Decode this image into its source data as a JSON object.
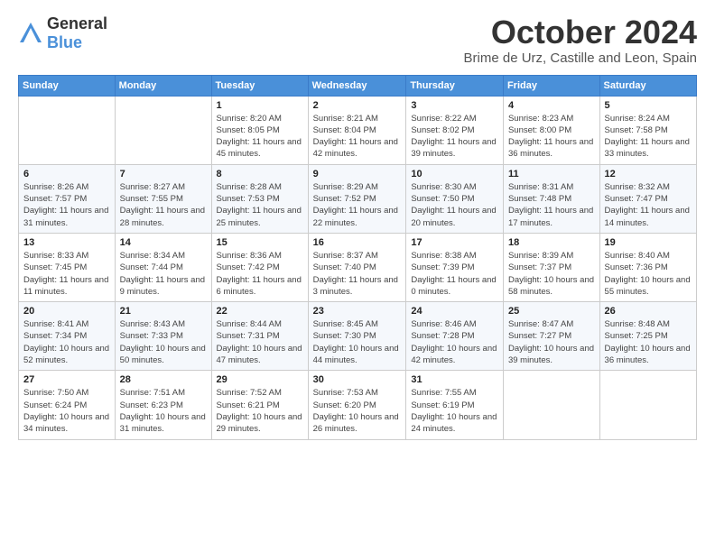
{
  "logo": {
    "general": "General",
    "blue": "Blue"
  },
  "header": {
    "month": "October 2024",
    "location": "Brime de Urz, Castille and Leon, Spain"
  },
  "weekdays": [
    "Sunday",
    "Monday",
    "Tuesday",
    "Wednesday",
    "Thursday",
    "Friday",
    "Saturday"
  ],
  "weeks": [
    [
      {
        "day": "",
        "detail": ""
      },
      {
        "day": "",
        "detail": ""
      },
      {
        "day": "1",
        "detail": "Sunrise: 8:20 AM\nSunset: 8:05 PM\nDaylight: 11 hours and 45 minutes."
      },
      {
        "day": "2",
        "detail": "Sunrise: 8:21 AM\nSunset: 8:04 PM\nDaylight: 11 hours and 42 minutes."
      },
      {
        "day": "3",
        "detail": "Sunrise: 8:22 AM\nSunset: 8:02 PM\nDaylight: 11 hours and 39 minutes."
      },
      {
        "day": "4",
        "detail": "Sunrise: 8:23 AM\nSunset: 8:00 PM\nDaylight: 11 hours and 36 minutes."
      },
      {
        "day": "5",
        "detail": "Sunrise: 8:24 AM\nSunset: 7:58 PM\nDaylight: 11 hours and 33 minutes."
      }
    ],
    [
      {
        "day": "6",
        "detail": "Sunrise: 8:26 AM\nSunset: 7:57 PM\nDaylight: 11 hours and 31 minutes."
      },
      {
        "day": "7",
        "detail": "Sunrise: 8:27 AM\nSunset: 7:55 PM\nDaylight: 11 hours and 28 minutes."
      },
      {
        "day": "8",
        "detail": "Sunrise: 8:28 AM\nSunset: 7:53 PM\nDaylight: 11 hours and 25 minutes."
      },
      {
        "day": "9",
        "detail": "Sunrise: 8:29 AM\nSunset: 7:52 PM\nDaylight: 11 hours and 22 minutes."
      },
      {
        "day": "10",
        "detail": "Sunrise: 8:30 AM\nSunset: 7:50 PM\nDaylight: 11 hours and 20 minutes."
      },
      {
        "day": "11",
        "detail": "Sunrise: 8:31 AM\nSunset: 7:48 PM\nDaylight: 11 hours and 17 minutes."
      },
      {
        "day": "12",
        "detail": "Sunrise: 8:32 AM\nSunset: 7:47 PM\nDaylight: 11 hours and 14 minutes."
      }
    ],
    [
      {
        "day": "13",
        "detail": "Sunrise: 8:33 AM\nSunset: 7:45 PM\nDaylight: 11 hours and 11 minutes."
      },
      {
        "day": "14",
        "detail": "Sunrise: 8:34 AM\nSunset: 7:44 PM\nDaylight: 11 hours and 9 minutes."
      },
      {
        "day": "15",
        "detail": "Sunrise: 8:36 AM\nSunset: 7:42 PM\nDaylight: 11 hours and 6 minutes."
      },
      {
        "day": "16",
        "detail": "Sunrise: 8:37 AM\nSunset: 7:40 PM\nDaylight: 11 hours and 3 minutes."
      },
      {
        "day": "17",
        "detail": "Sunrise: 8:38 AM\nSunset: 7:39 PM\nDaylight: 11 hours and 0 minutes."
      },
      {
        "day": "18",
        "detail": "Sunrise: 8:39 AM\nSunset: 7:37 PM\nDaylight: 10 hours and 58 minutes."
      },
      {
        "day": "19",
        "detail": "Sunrise: 8:40 AM\nSunset: 7:36 PM\nDaylight: 10 hours and 55 minutes."
      }
    ],
    [
      {
        "day": "20",
        "detail": "Sunrise: 8:41 AM\nSunset: 7:34 PM\nDaylight: 10 hours and 52 minutes."
      },
      {
        "day": "21",
        "detail": "Sunrise: 8:43 AM\nSunset: 7:33 PM\nDaylight: 10 hours and 50 minutes."
      },
      {
        "day": "22",
        "detail": "Sunrise: 8:44 AM\nSunset: 7:31 PM\nDaylight: 10 hours and 47 minutes."
      },
      {
        "day": "23",
        "detail": "Sunrise: 8:45 AM\nSunset: 7:30 PM\nDaylight: 10 hours and 44 minutes."
      },
      {
        "day": "24",
        "detail": "Sunrise: 8:46 AM\nSunset: 7:28 PM\nDaylight: 10 hours and 42 minutes."
      },
      {
        "day": "25",
        "detail": "Sunrise: 8:47 AM\nSunset: 7:27 PM\nDaylight: 10 hours and 39 minutes."
      },
      {
        "day": "26",
        "detail": "Sunrise: 8:48 AM\nSunset: 7:25 PM\nDaylight: 10 hours and 36 minutes."
      }
    ],
    [
      {
        "day": "27",
        "detail": "Sunrise: 7:50 AM\nSunset: 6:24 PM\nDaylight: 10 hours and 34 minutes."
      },
      {
        "day": "28",
        "detail": "Sunrise: 7:51 AM\nSunset: 6:23 PM\nDaylight: 10 hours and 31 minutes."
      },
      {
        "day": "29",
        "detail": "Sunrise: 7:52 AM\nSunset: 6:21 PM\nDaylight: 10 hours and 29 minutes."
      },
      {
        "day": "30",
        "detail": "Sunrise: 7:53 AM\nSunset: 6:20 PM\nDaylight: 10 hours and 26 minutes."
      },
      {
        "day": "31",
        "detail": "Sunrise: 7:55 AM\nSunset: 6:19 PM\nDaylight: 10 hours and 24 minutes."
      },
      {
        "day": "",
        "detail": ""
      },
      {
        "day": "",
        "detail": ""
      }
    ]
  ]
}
